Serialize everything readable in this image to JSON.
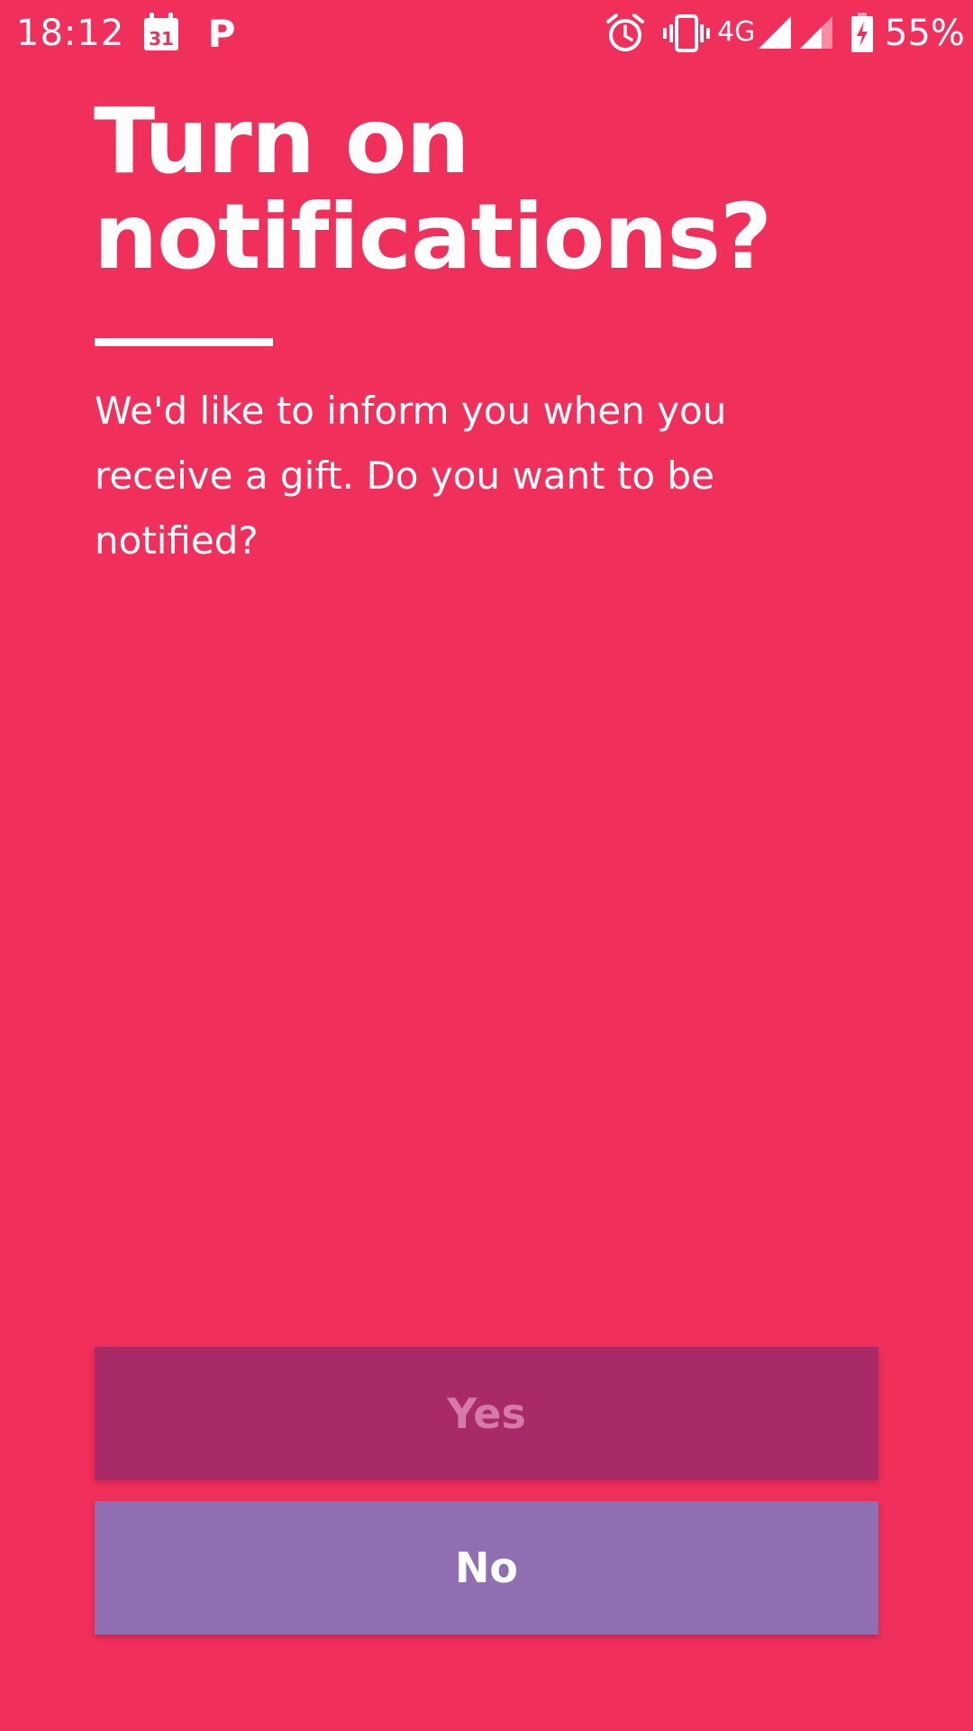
{
  "status_bar": {
    "time": "18:12",
    "calendar_day": "31",
    "parking_letter": "P",
    "network": "4G",
    "battery_percent": "55%",
    "icons": [
      "calendar-icon",
      "parking-app-icon",
      "alarm-icon",
      "vibrate-icon",
      "signal-icon",
      "signal-icon",
      "battery-charging-icon"
    ]
  },
  "dialog": {
    "title": "Turn on notifications?",
    "message": "We'd like to inform you when you receive a gift. Do you want to be notified?"
  },
  "buttons": {
    "yes_label": "Yes",
    "no_label": "No"
  },
  "colors": {
    "background": "#F0305B",
    "yes_button": "#A82A66",
    "yes_text": "#D37AA6",
    "no_button": "#8F6EB1",
    "text": "#FFFFFF"
  }
}
